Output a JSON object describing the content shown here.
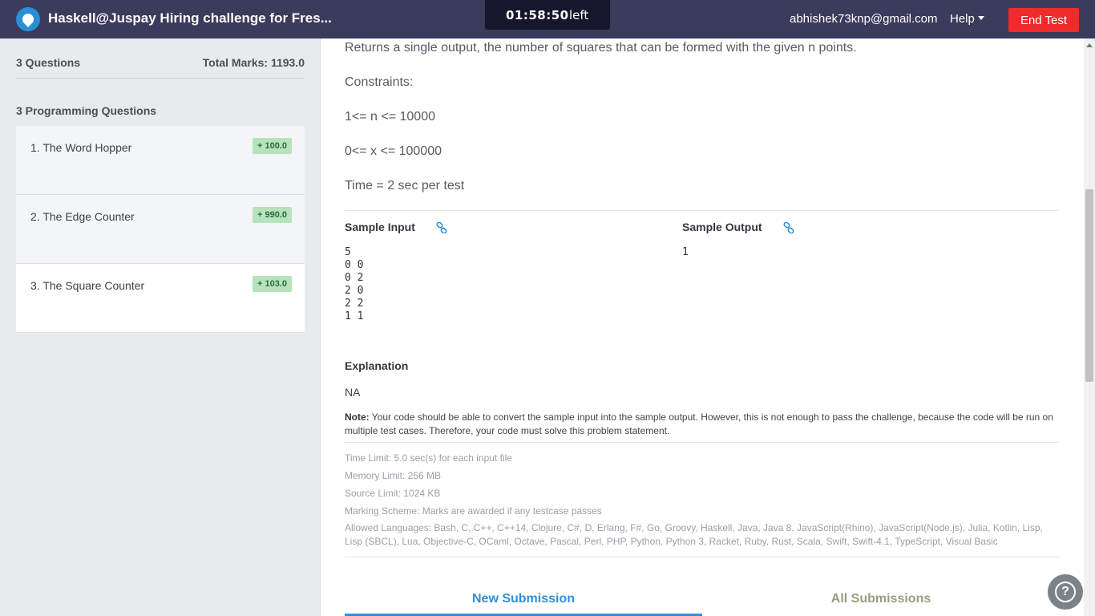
{
  "header": {
    "title": "Haskell@Juspay Hiring challenge for Fres...",
    "timer_value": "01:58:50",
    "timer_suffix": "left",
    "user_email": "abhishek73knp@gmail.com",
    "help_label": "Help",
    "end_test_label": "End Test"
  },
  "sidebar": {
    "question_count": "3 Questions",
    "total_marks": "Total Marks: 1193.0",
    "section_title": "3 Programming Questions",
    "questions": [
      {
        "title": "1. The Word Hopper",
        "marks": "+ 100.0"
      },
      {
        "title": "2. The Edge Counter",
        "marks": "+ 990.0"
      },
      {
        "title": "3. The Square Counter",
        "marks": "+ 103.0"
      }
    ]
  },
  "problem": {
    "output_text": "Returns a single output, the number of squares that can be formed with the given n points.",
    "constraints_label": "Constraints:",
    "constraint_n": "1<= n <= 10000",
    "constraint_x": "0<= x <= 100000",
    "time_line": "Time  = 2 sec per test",
    "sample_input_label": "Sample Input",
    "sample_output_label": "Sample Output",
    "sample_input": "5\n0 0\n0 2\n2 0\n2 2\n1 1",
    "sample_output": "1",
    "explanation_label": "Explanation",
    "explanation": "NA",
    "note_label": "Note:",
    "note_text": " Your code should be able to convert the sample input into the sample output. However, this is not enough to pass the challenge, because the code will be run on multiple test cases. Therefore, your code must solve this problem statement.",
    "time_limit": "Time Limit: 5.0 sec(s) for each input file",
    "memory_limit": "Memory Limit: 256 MB",
    "source_limit": "Source Limit: 1024 KB",
    "marking_scheme": "Marking Scheme: Marks are awarded if any testcase passes",
    "allowed_languages": "Allowed Languages: Bash, C, C++, C++14, Clojure, C#, D, Erlang, F#, Go, Groovy, Haskell, Java, Java 8, JavaScript(Rhino), JavaScript(Node.js), Julia, Kotlin, Lisp, Lisp (SBCL), Lua, Objective-C, OCaml, Octave, Pascal, Perl, PHP, Python, Python 3, Racket, Ruby, Rust, Scala, Swift, Swift-4.1, TypeScript, Visual Basic"
  },
  "tabs": {
    "new_submission": "New Submission",
    "all_submissions": "All Submissions"
  },
  "icons": {
    "logo": "logo-icon",
    "link": "link-icon",
    "help_fab": "question-icon"
  },
  "colors": {
    "header_bg": "#3b3b5c",
    "end_test": "#ef2b2b",
    "accent": "#2f8fdb",
    "badge_bg": "#b6e3bd"
  }
}
